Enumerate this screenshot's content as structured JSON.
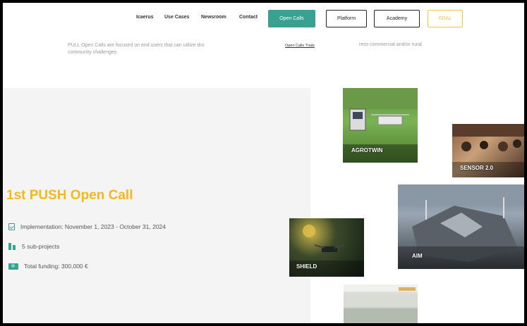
{
  "nav": {
    "links": [
      "Icaerus",
      "Use Cases",
      "Newsroom",
      "Contact"
    ],
    "open_calls": "Open Calls",
    "platform": "Platform",
    "academy": "Academy",
    "edal": "EDAL"
  },
  "intro": {
    "text": "PULL Open Calls are focused on end users that can utilize dro",
    "text_line2": "community challenges.",
    "tooltip": "Open Calls Trials",
    "text_right": "ress commercial and/or rural"
  },
  "call": {
    "title": "1st PUSH Open Call",
    "implementation": "Implementation: November 1, 2023 - October 31, 2024",
    "subprojects": "5 sub-projects",
    "funding": "Total funding: 300,000 €"
  },
  "tiles": {
    "agrotwin": "AGROTWIN",
    "sensor": "SENSOR 2.0",
    "aim": "AIM",
    "shield": "SHIELD"
  },
  "colors": {
    "accent": "#3aa08f",
    "title": "#f4b71e",
    "edal": "#f5c342"
  },
  "icons": [
    "calendar-check-icon",
    "people-icon",
    "money-icon"
  ]
}
